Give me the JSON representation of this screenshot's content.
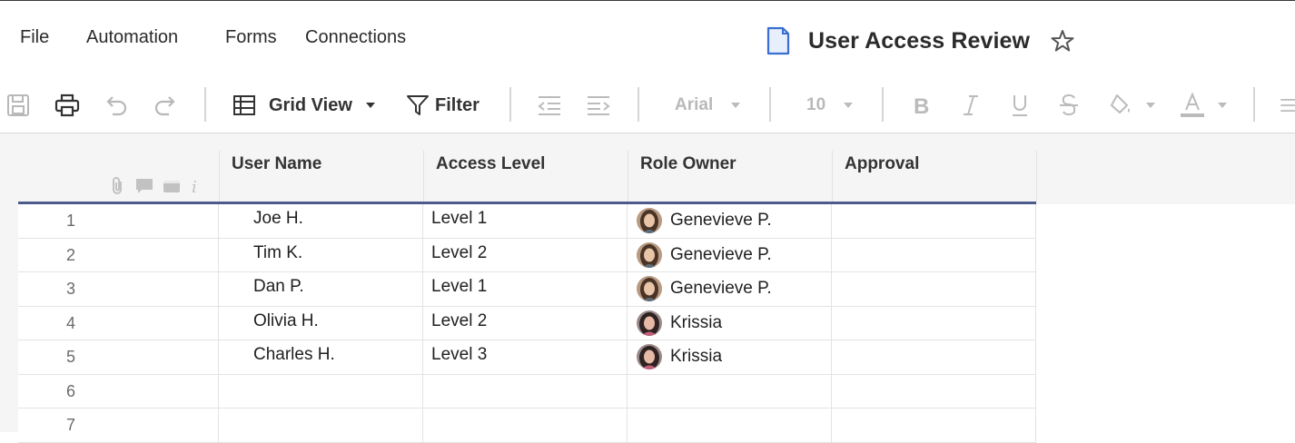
{
  "menu": {
    "items": [
      {
        "label": "File"
      },
      {
        "label": "Automation"
      },
      {
        "label": "Forms"
      },
      {
        "label": "Connections"
      }
    ]
  },
  "document": {
    "title": "User Access Review",
    "icon": "document-icon",
    "favorite_icon": "star-icon"
  },
  "toolbar": {
    "view_label": "Grid View",
    "filter_label": "Filter",
    "font_family": "Arial",
    "font_size": "10",
    "icons": [
      "save-icon",
      "print-icon",
      "undo-icon",
      "redo-icon",
      "grid-view-icon",
      "filter-icon",
      "outdent-icon",
      "indent-icon",
      "bold-icon",
      "italic-icon",
      "underline-icon",
      "strikethrough-icon",
      "fill-color-icon",
      "text-color-icon",
      "align-icon"
    ]
  },
  "grid": {
    "header_icons": [
      "attachment-icon",
      "comment-icon",
      "proof-icon",
      "info-icon"
    ],
    "columns": [
      {
        "label": "User Name"
      },
      {
        "label": "Access Level"
      },
      {
        "label": "Role Owner"
      },
      {
        "label": "Approval"
      }
    ],
    "rows": [
      {
        "num": "1",
        "user": "Joe H.",
        "access": "Level 1",
        "owner": "Genevieve P.",
        "approval": ""
      },
      {
        "num": "2",
        "user": "Tim K.",
        "access": "Level 2",
        "owner": "Genevieve P.",
        "approval": ""
      },
      {
        "num": "3",
        "user": "Dan P.",
        "access": "Level 1",
        "owner": "Genevieve P.",
        "approval": ""
      },
      {
        "num": "4",
        "user": "Olivia H.",
        "access": "Level 2",
        "owner": "Krissia",
        "approval": ""
      },
      {
        "num": "5",
        "user": "Charles H.",
        "access": "Level 3",
        "owner": "Krissia",
        "approval": ""
      },
      {
        "num": "6",
        "user": "",
        "access": "",
        "owner": "",
        "approval": ""
      },
      {
        "num": "7",
        "user": "",
        "access": "",
        "owner": "",
        "approval": ""
      }
    ]
  },
  "colors": {
    "header_underline": "#4d5b8c",
    "doc_icon": "#3a6fd1"
  }
}
